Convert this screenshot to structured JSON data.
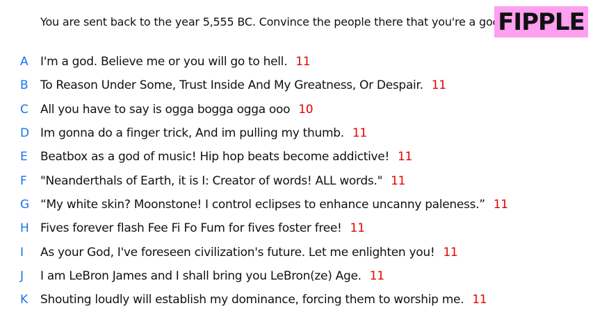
{
  "header": {
    "prompt": "You are sent back to the year 5,555 BC. Convince the people there that you're a god.",
    "logo": "FIPPLE"
  },
  "colors": {
    "letter": "#1a73e8",
    "score": "#e60000",
    "logo_bg": "#ff9ff0",
    "text": "#111111"
  },
  "answers": [
    {
      "letter": "A",
      "text": "I'm a god. Believe me or you will go to hell.",
      "score": "11"
    },
    {
      "letter": "B",
      "text": "To Reason Under Some, Trust Inside And My Greatness, Or Despair.",
      "score": "11"
    },
    {
      "letter": "C",
      "text": "All you have to say is ogga bogga ogga ooo",
      "score": "10"
    },
    {
      "letter": "D",
      "text": "Im gonna do a finger trick, And im pulling my thumb.",
      "score": "11"
    },
    {
      "letter": "E",
      "text": "Beatbox as a god of music! Hip hop beats become addictive!",
      "score": "11"
    },
    {
      "letter": "F",
      "text": "\"Neanderthals of Earth, it is I: Creator of words! ALL words.\"",
      "score": "11"
    },
    {
      "letter": "G",
      "text": "“My white skin? Moonstone! I control eclipses to enhance uncanny paleness.”",
      "score": "11"
    },
    {
      "letter": "H",
      "text": "Fives forever flash Fee Fi Fo Fum for fives foster free!",
      "score": "11"
    },
    {
      "letter": "I",
      "text": "As your God, I've foreseen civilization's future. Let me enlighten you!",
      "score": "11"
    },
    {
      "letter": "J",
      "text": "I am LeBron James and I shall bring you LeBron(ze) Age.",
      "score": "11"
    },
    {
      "letter": "K",
      "text": "Shouting loudly will establish my dominance, forcing them to worship me.",
      "score": "11"
    }
  ]
}
